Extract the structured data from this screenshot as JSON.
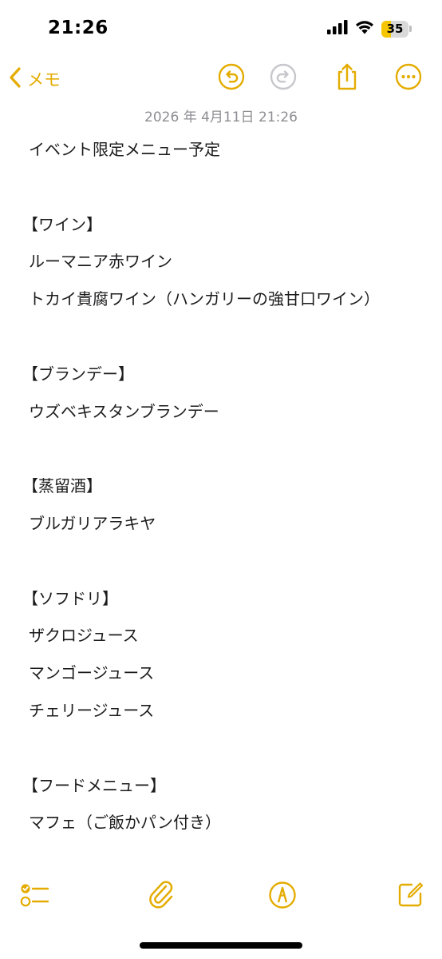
{
  "status_bar": {
    "time": "21:26",
    "battery_level": "35",
    "battery_fraction": 0.35
  },
  "nav": {
    "back_label": "メモ",
    "accent_color": "#E4AC00",
    "icons": [
      "chevron-left-icon",
      "undo-icon",
      "redo-icon",
      "share-icon",
      "more-icon"
    ]
  },
  "note": {
    "date": "2026 年 4月11日 21:26",
    "lines": [
      "イベント限定メニュー予定",
      "",
      "【ワイン】",
      "ルーマニア赤ワイン",
      "トカイ貴腐ワイン（ハンガリーの強甘口ワイン）",
      "",
      "【ブランデー】",
      "ウズベキスタンブランデー",
      "",
      "【蒸留酒】",
      "ブルガリアラキヤ",
      "",
      "【ソフドリ】",
      "ザクロジュース",
      "マンゴージュース",
      "チェリージュース",
      "",
      "【フードメニュー】",
      "マフェ（ご飯かパン付き）"
    ]
  },
  "toolbar": {
    "icons": [
      "checklist-icon",
      "paperclip-icon",
      "markup-pen-icon",
      "compose-icon"
    ]
  }
}
